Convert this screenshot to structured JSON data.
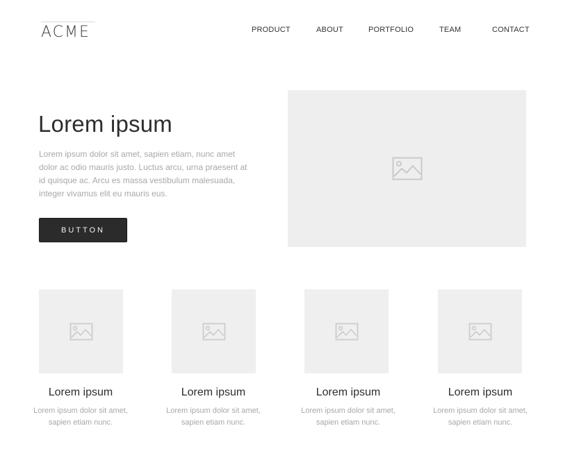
{
  "header": {
    "logo": "ACME",
    "nav": [
      {
        "label": "PRODUCT"
      },
      {
        "label": "ABOUT"
      },
      {
        "label": "PORTFOLIO"
      },
      {
        "label": "TEAM"
      },
      {
        "label": "CONTACT"
      }
    ]
  },
  "hero": {
    "title": "Lorem ipsum",
    "text": "Lorem ipsum dolor sit amet, sapien etiam, nunc amet dolor ac odio mauris justo. Luctus arcu, urna praesent at id quisque ac. Arcu es massa vestibulum malesuada, integer vivamus elit eu mauris eus.",
    "button_label": "BUTTON",
    "image_icon": "image-placeholder-icon"
  },
  "cards": [
    {
      "title": "Lorem ipsum",
      "text": "Lorem ipsum dolor sit amet, sapien etiam nunc."
    },
    {
      "title": "Lorem ipsum",
      "text": "Lorem ipsum dolor sit amet, sapien etiam nunc."
    },
    {
      "title": "Lorem ipsum",
      "text": "Lorem ipsum dolor sit amet, sapien etiam nunc."
    },
    {
      "title": "Lorem ipsum",
      "text": "Lorem ipsum dolor sit amet, sapien etiam nunc."
    }
  ],
  "colors": {
    "button_bg": "#2b2b2b",
    "placeholder_bg": "#eeeeee",
    "muted_text": "#a8a8a8",
    "heading_text": "#2d2d2d"
  }
}
